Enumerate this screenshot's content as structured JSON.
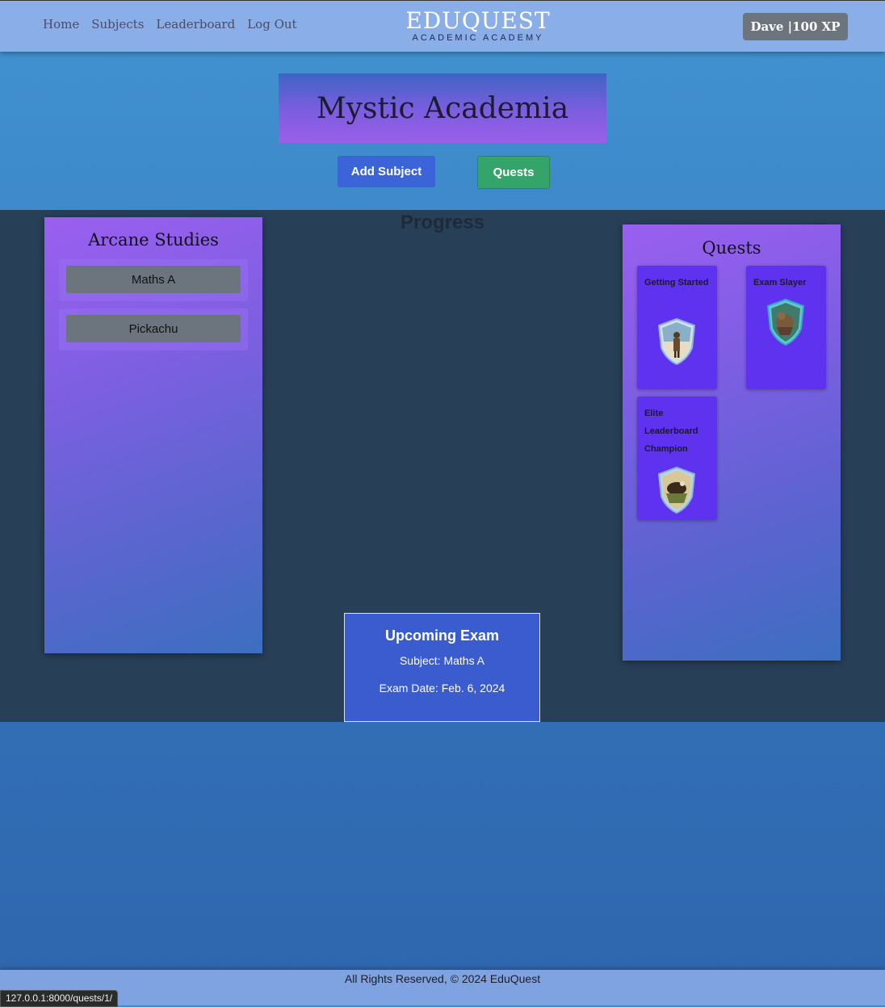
{
  "nav": {
    "links": [
      "Home",
      "Subjects",
      "Leaderboard",
      "Log Out"
    ],
    "brand_name": "EDUQUEST",
    "brand_sub": "ACADEMIC ACADEMY",
    "user_badge": "Dave |100 XP"
  },
  "hero": {
    "title": "Mystic Academia",
    "add_subject": "Add Subject",
    "quests": "Quests"
  },
  "progress_title": "Progress",
  "subjects_panel": {
    "title": "Arcane Studies",
    "items": [
      "Maths A",
      "Pickachu"
    ]
  },
  "quests_panel": {
    "title": "Quests",
    "items": [
      {
        "name": "Getting Started",
        "icon": "adventurer-shield-icon"
      },
      {
        "name": "Exam Slayer",
        "icon": "beast-shield-icon"
      },
      {
        "name": "Elite Leaderboard Champion",
        "icon": "champion-shield-icon"
      }
    ]
  },
  "exam": {
    "title": "Upcoming Exam",
    "subject": "Subject: Maths A",
    "date": "Exam Date: Feb. 6, 2024"
  },
  "footer": "All Rights Reserved, © 2024 EduQuest",
  "status_url": "127.0.0.1:8000/quests/1/"
}
